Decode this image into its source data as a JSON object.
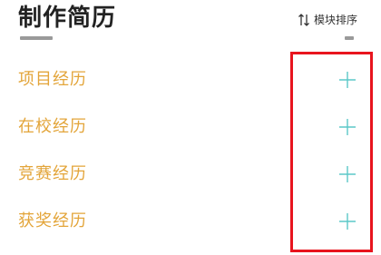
{
  "header": {
    "title": "制作简历",
    "sort_label": "模块排序",
    "sort_icon": "sort-arrows-icon"
  },
  "sections": [
    {
      "label": "项目经历",
      "action_icon": "plus-icon"
    },
    {
      "label": "在校经历",
      "action_icon": "plus-icon"
    },
    {
      "label": "竞赛经历",
      "action_icon": "plus-icon"
    },
    {
      "label": "获奖经历",
      "action_icon": "plus-icon"
    }
  ],
  "colors": {
    "title": "#222222",
    "section_label": "#e3a53a",
    "plus_icon": "#5bc8c8",
    "highlight": "#e8141e"
  }
}
